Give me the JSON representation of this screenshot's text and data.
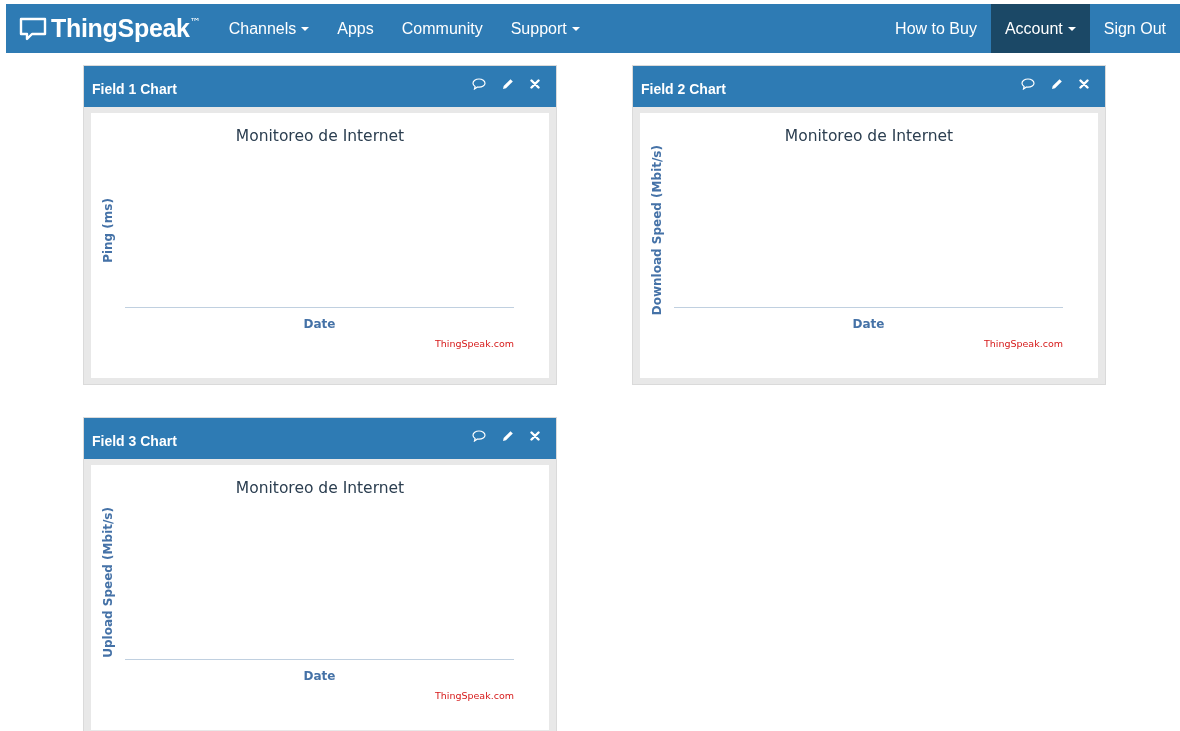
{
  "navbar": {
    "brand": "ThingSpeak",
    "trademark": "™",
    "left_items": [
      {
        "label": "Channels",
        "dropdown": true,
        "selected": false
      },
      {
        "label": "Apps",
        "dropdown": false,
        "selected": false
      },
      {
        "label": "Community",
        "dropdown": false,
        "selected": false
      },
      {
        "label": "Support",
        "dropdown": true,
        "selected": false
      }
    ],
    "right_items": [
      {
        "label": "How to Buy",
        "dropdown": false,
        "selected": false
      },
      {
        "label": "Account",
        "dropdown": true,
        "selected": true
      },
      {
        "label": "Sign Out",
        "dropdown": false,
        "selected": false
      }
    ]
  },
  "cards": [
    {
      "title": "Field 1 Chart",
      "chart_title": "Monitoreo de Internet",
      "ylabel": "Ping (ms)",
      "xlabel": "Date",
      "credit": "ThingSpeak.com"
    },
    {
      "title": "Field 2 Chart",
      "chart_title": "Monitoreo de Internet",
      "ylabel": "Download Speed (Mbit/s)",
      "xlabel": "Date",
      "credit": "ThingSpeak.com"
    },
    {
      "title": "Field 3 Chart",
      "chart_title": "Monitoreo de Internet",
      "ylabel": "Upload Speed (Mbit/s)",
      "xlabel": "Date",
      "credit": "ThingSpeak.com"
    }
  ]
}
